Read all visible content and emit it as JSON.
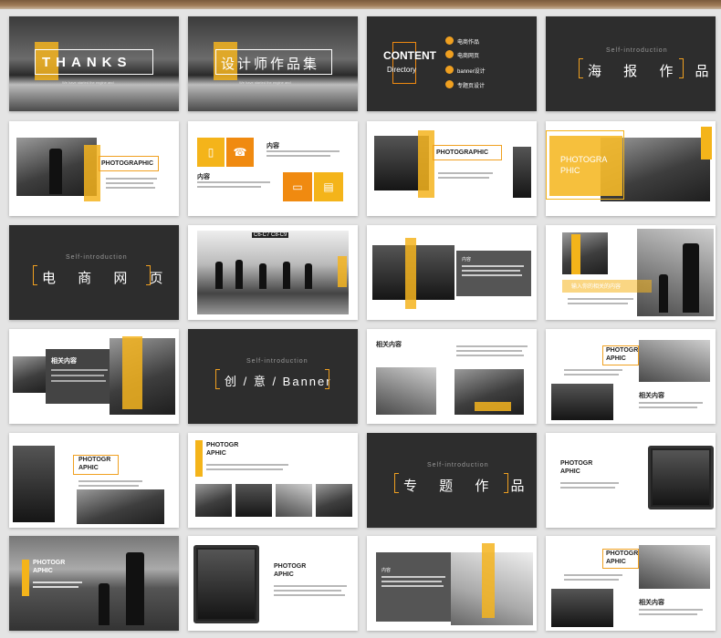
{
  "slides": {
    "s1": {
      "title": "THANKS",
      "sub": "We have started the engine and"
    },
    "s2": {
      "title": "设计师作品集",
      "sub": "We have started the engine and"
    },
    "s3": {
      "title": "CONTENT",
      "subtitle": "Directory",
      "items": [
        "电商作品",
        "电商网页",
        "banner设计",
        "专题页设计"
      ]
    },
    "s4": {
      "label": "Self-introduction",
      "title": "海 报 作 品"
    },
    "s5": {
      "title": "PHOTOGRAPHIC"
    },
    "s6": {
      "label1": "内容",
      "label2": "内容"
    },
    "s7": {
      "title": "PHOTOGRAPHIC"
    },
    "s8": {
      "title1": "PHOTOGRA",
      "title2": "PHIC"
    },
    "s9": {
      "label": "Self-introduction",
      "title": "电 商 网 页"
    },
    "s10": {
      "sign": "C6-C7  C8-C9"
    },
    "s11": {
      "label": "内容"
    },
    "s12": {
      "caption": "输入你的相关的内容"
    },
    "s13": {
      "title": "相关内容"
    },
    "s14": {
      "label": "Self-introduction",
      "title": "创 / 意 / Banner"
    },
    "s15": {
      "title": "相关内容"
    },
    "s16": {
      "title1": "PHOTOGR",
      "title2": "APHIC",
      "label": "相关内容"
    },
    "s17": {
      "title1": "PHOTOGR",
      "title2": "APHIC"
    },
    "s18": {
      "title1": "PHOTOGR",
      "title2": "APHIC"
    },
    "s19": {
      "label": "Self-introduction",
      "title": "专 题 作 品"
    },
    "s20": {
      "title1": "PHOTOGR",
      "title2": "APHIC"
    },
    "s21": {
      "title1": "PHOTOGR",
      "title2": "APHIC"
    },
    "s22": {
      "title1": "PHOTOGR",
      "title2": "APHIC"
    },
    "s23": {
      "label": "内容"
    },
    "s24": {
      "title1": "PHOTOGR",
      "title2": "APHIC",
      "label": "相关内容"
    }
  },
  "colors": {
    "accent": "#f4b41a",
    "accent_dark": "#f08a10",
    "dark": "#2d2d2d"
  }
}
